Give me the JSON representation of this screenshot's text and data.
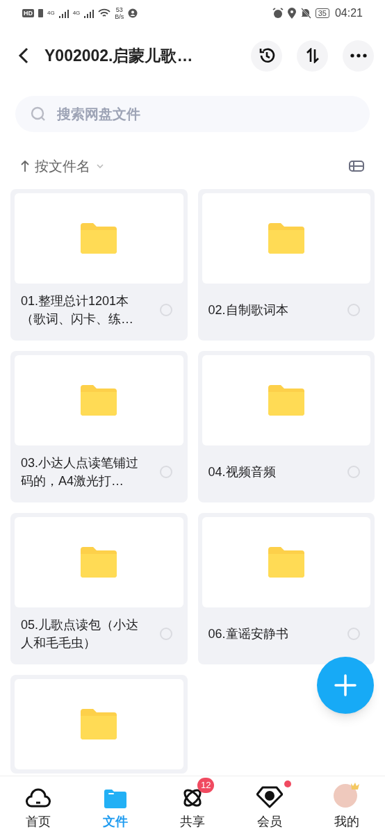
{
  "status_bar": {
    "hd": "HD",
    "network_1": "4G",
    "network_2": "4G",
    "speed_value": "53",
    "speed_unit": "B/s",
    "battery": "35",
    "time": "04:21"
  },
  "header": {
    "title": "Y002002.启蒙儿歌…"
  },
  "search": {
    "placeholder": "搜索网盘文件"
  },
  "sort": {
    "label": "按文件名"
  },
  "files": [
    {
      "name": "01.整理总计1201本（歌词、闪卡、练…",
      "selected": false
    },
    {
      "name": "02.自制歌词本",
      "selected": false
    },
    {
      "name": "03.小达人点读笔铺过码的，A4激光打…",
      "selected": false
    },
    {
      "name": "04.视频音频",
      "selected": false
    },
    {
      "name": "05.儿歌点读包（小达人和毛毛虫）",
      "selected": false
    },
    {
      "name": "06.童谣安静书",
      "selected": false
    },
    {
      "kind": "partial"
    }
  ],
  "nav": [
    {
      "kind": "home",
      "label": "首页",
      "selected": false
    },
    {
      "kind": "files",
      "label": "文件",
      "selected": true
    },
    {
      "kind": "share",
      "label": "共享",
      "selected": false,
      "badge": "12"
    },
    {
      "kind": "vip",
      "label": "会员",
      "selected": false,
      "dot": true
    },
    {
      "kind": "me",
      "label": "我的",
      "selected": false
    }
  ]
}
